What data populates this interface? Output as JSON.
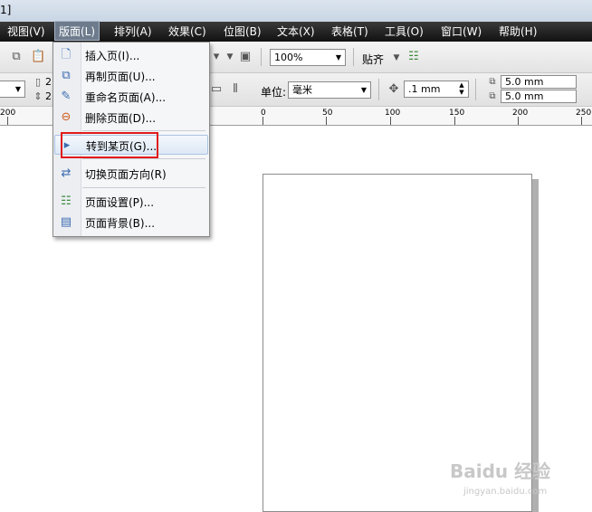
{
  "window": {
    "title_fragment": "1]"
  },
  "menubar": {
    "items": [
      "视图(V)",
      "版面(L)",
      "排列(A)",
      "效果(C)",
      "位图(B)",
      "文本(X)",
      "表格(T)",
      "工具(O)",
      "窗口(W)",
      "帮助(H)"
    ],
    "active": "版面(L)"
  },
  "toolbar": {
    "zoom_value": "100%",
    "snap_label": "贴齐",
    "unit_label": "单位:",
    "unit_value": "毫米",
    "nudge_value": ".1 mm",
    "dup_x": "5.0 mm",
    "dup_y": "5.0 mm",
    "left_val1": "2",
    "left_val2": "2"
  },
  "ruler": {
    "labels": [
      "200",
      "0",
      "50",
      "100",
      "150",
      "200",
      "250"
    ]
  },
  "dropdown": {
    "items": [
      {
        "label": "插入页(I)...",
        "icon": "insert-page-icon"
      },
      {
        "label": "再制页面(U)...",
        "icon": "duplicate-page-icon"
      },
      {
        "label": "重命名页面(A)...",
        "icon": "rename-page-icon"
      },
      {
        "label": "删除页面(D)...",
        "icon": "delete-page-icon"
      },
      {
        "label": "转到某页(G)...",
        "icon": "goto-page-icon"
      },
      {
        "label": "切换页面方向(R)",
        "icon": "switch-orientation-icon"
      },
      {
        "label": "页面设置(P)...",
        "icon": "page-setup-icon"
      },
      {
        "label": "页面背景(B)...",
        "icon": "page-background-icon"
      }
    ],
    "hovered": "转到某页(G)..."
  },
  "watermark": {
    "line1": "Baidu 经验",
    "line2": "jingyan.baidu.com"
  }
}
